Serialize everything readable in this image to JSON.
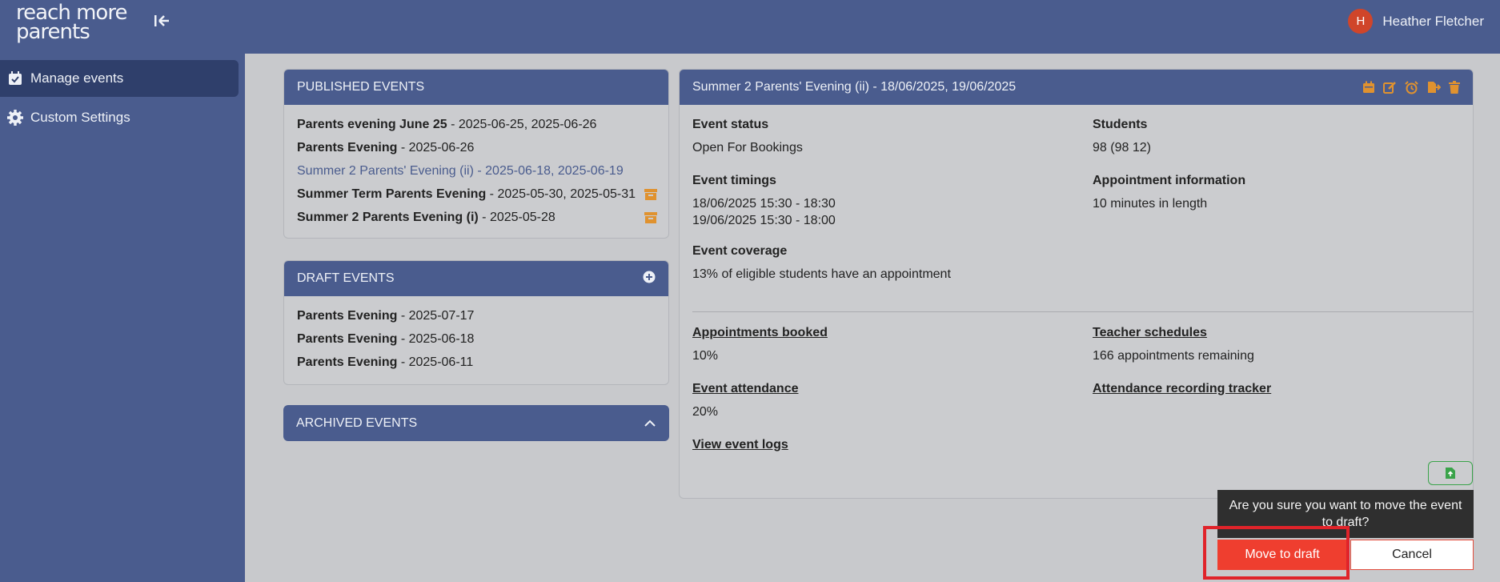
{
  "brand": {
    "logo_line1": "reach more",
    "logo_line2": "parents"
  },
  "user": {
    "initial": "H",
    "name": "Heather Fletcher"
  },
  "sidebar": {
    "items": [
      {
        "label": "Manage events"
      },
      {
        "label": "Custom Settings"
      }
    ]
  },
  "published": {
    "title": "PUBLISHED EVENTS",
    "events": [
      {
        "name": "Parents evening June 25",
        "dates": " - 2025-06-25, 2025-06-26"
      },
      {
        "name": "Parents Evening",
        "dates": " - 2025-06-26"
      },
      {
        "name": "Summer 2 Parents' Evening (ii)",
        "dates": " - 2025-06-18, 2025-06-19"
      },
      {
        "name": "Summer Term Parents Evening",
        "dates": " - 2025-05-30, 2025-05-31"
      },
      {
        "name": "Summer 2 Parents Evening (i)",
        "dates": " - 2025-05-28"
      }
    ]
  },
  "drafts": {
    "title": "DRAFT EVENTS",
    "events": [
      {
        "name": "Parents Evening",
        "dates": " - 2025-07-17"
      },
      {
        "name": "Parents Evening",
        "dates": " - 2025-06-18"
      },
      {
        "name": "Parents Evening",
        "dates": " - 2025-06-11"
      }
    ]
  },
  "archived": {
    "title": "ARCHIVED EVENTS"
  },
  "detail": {
    "title": "Summer 2 Parents' Evening (ii) - 18/06/2025, 19/06/2025",
    "status_label": "Event status",
    "status_value": "Open For Bookings",
    "students_label": "Students",
    "students_value": "98 (98 12)",
    "timings_label": "Event timings",
    "timing_1": "18/06/2025 15:30 - 18:30",
    "timing_2": "19/06/2025 15:30 - 18:00",
    "appt_info_label": "Appointment information",
    "appt_info_value": "10 minutes in length",
    "coverage_label": "Event coverage",
    "coverage_value": "13% of eligible students have an appointment",
    "booked_link": "Appointments booked",
    "booked_value": "10%",
    "schedules_link": "Teacher schedules",
    "schedules_value": "166 appointments remaining",
    "attendance_link": "Event attendance",
    "attendance_value": "20%",
    "tracker_link": "Attendance recording tracker",
    "logs_link": "View event logs"
  },
  "confirm": {
    "message": "Are you sure you want to move the event to draft?",
    "confirm_label": "Move to draft",
    "cancel_label": "Cancel"
  },
  "colors": {
    "header": "#4a5c8e",
    "active_nav": "#2f3f6b",
    "accent_orange": "#e0922f",
    "danger": "#ef3e2f",
    "success": "#3aa34a"
  }
}
